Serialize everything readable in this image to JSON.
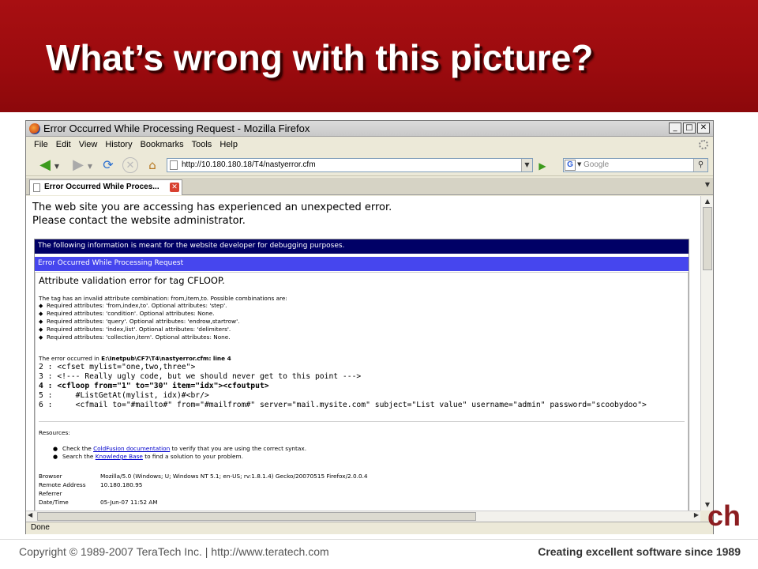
{
  "slide": {
    "title": "What’s wrong with this picture?",
    "logo_fragment": "ch",
    "footer_left": "Copyright © 1989-2007 TeraTech Inc. | http://www.teratech.com",
    "footer_right": "Creating excellent software since 1989"
  },
  "browser": {
    "window_title": "Error Occurred While Processing Request - Mozilla Firefox",
    "title_buttons": [
      "_",
      "□",
      "✕"
    ],
    "menu": [
      "File",
      "Edit",
      "View",
      "History",
      "Bookmarks",
      "Tools",
      "Help"
    ],
    "url": "http://10.180.180.18/T4/nastyerror.cfm",
    "search_placeholder": "Google",
    "tab_title": "Error Occurred While Proces...",
    "status": "Done"
  },
  "page": {
    "error_heading_line1": "The web site you are accessing has experienced an unexpected error.",
    "error_heading_line2": "Please contact the website administrator.",
    "debug_notice": "The following information is meant for the website developer for debugging purposes.",
    "error_bar": "Error Occurred While Processing Request",
    "error_title": "Attribute validation error for tag CFLOOP.",
    "description": "The tag has an invalid attribute combination: from,item,to. Possible combinations are:",
    "combinations": [
      "Required attributes: 'from,index,to'. Optional attributes: 'step'.",
      "Required attributes: 'condition'. Optional attributes: None.",
      "Required attributes: 'query'. Optional attributes: 'endrow,startrow'.",
      "Required attributes: 'index,list'. Optional attributes: 'delimiters'.",
      "Required attributes: 'collection,item'. Optional attributes: None."
    ],
    "location_prefix": "The error occurred in",
    "location_file": "E:\\Inetpub\\CF7\\T4\\nastyerror.cfm: line 4",
    "code_lines": [
      "2 : <cfset mylist=\"one,two,three\">",
      "3 : <!--- Really ugly code, but we should never get to this point --->",
      "4 : <cfloop from=\"1\" to=\"30\" item=\"idx\"><cfoutput>",
      "5 :     #ListGetAt(mylist, idx)#<br/>",
      "6 :     <cfmail to=\"#mailto#\" from=\"#mailfrom#\" server=\"mail.mysite.com\" subject=\"List value\" username=\"admin\" password=\"scoobydoo\">"
    ],
    "resources_label": "Resources:",
    "resource1_pre": "Check the",
    "resource1_link": "ColdFusion documentation",
    "resource1_post": "to verify that you are using the correct syntax.",
    "resource2_pre": "Search the",
    "resource2_link": "Knowledge Base",
    "resource2_post": "to find a solution to your problem.",
    "info": [
      {
        "key": "Browser",
        "value": "Mozilla/5.0 (Windows; U; Windows NT 5.1; en-US; rv:1.8.1.4) Gecko/20070515 Firefox/2.0.0.4"
      },
      {
        "key": "Remote Address",
        "value": "10.180.180.95"
      },
      {
        "key": "Referrer",
        "value": ""
      },
      {
        "key": "Date/Time",
        "value": "05-Jun-07 11:52 AM"
      }
    ]
  },
  "colors": {
    "header_red": "#9b0b0e",
    "debug_bar": "#000066",
    "error_bar": "#4646ee",
    "link": "#0000cc"
  }
}
